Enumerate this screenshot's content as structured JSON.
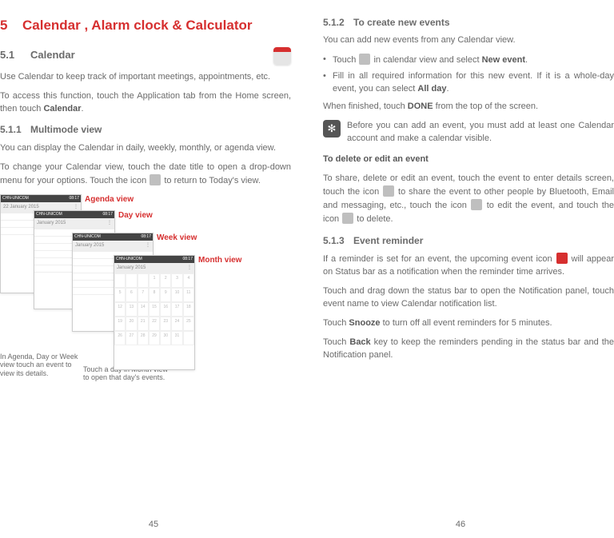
{
  "left": {
    "chapter_num": "5",
    "chapter_title": "Calendar , Alarm clock & Calculator",
    "s1_num": "5.1",
    "s1_title": "Calendar",
    "s1_p1a": "Use Calendar to keep track of important meetings, appointments, etc.",
    "s1_p2a": "To access this function, touch the Application tab from the Home screen, then touch ",
    "s1_p2b": "Calendar",
    "s1_p2c": ".",
    "s11_num": "5.1.1",
    "s11_title": "Multimode view",
    "s11_p1": "You can display the Calendar in daily, weekly, monthly, or agenda view.",
    "s11_p2a": "To change your Calendar view, touch the date title to open a drop-down menu for your options. Touch the icon ",
    "s11_p2b": " to return to Today's view.",
    "cap_agenda": "Agenda view",
    "cap_day": "Day view",
    "cap_week": "Week view",
    "cap_month": "Month view",
    "fn1": "In Agenda, Day or Week view touch an event to view its details.",
    "fn2": "Touch a day in Month view to open that day's events.",
    "phone_date": "22 January 2015",
    "phone_month": "January 2015",
    "page_num": "45"
  },
  "right": {
    "s12_num": "5.1.2",
    "s12_title": "To create new events",
    "s12_p1": "You can add new events from any Calendar view.",
    "s12_b1a": "Touch ",
    "s12_b1b": " in calendar view and select ",
    "s12_b1c": "New event",
    "s12_b1d": ".",
    "s12_b2a": "Fill in all required information for this new event. If it is a whole-day event, you can select ",
    "s12_b2b": "All day",
    "s12_b2c": ".",
    "s12_p2a": "When finished, touch ",
    "s12_p2b": "DONE",
    "s12_p2c": " from the top of the screen.",
    "s12_note": "Before you can add an event, you must add at least one Calendar account and make a calendar visible.",
    "del_title": "To delete or edit an event",
    "del_p1a": "To share, delete or edit an event, touch the event to enter details screen, touch the icon ",
    "del_p1b": " to share the event to other people by Bluetooth, Email and messaging, etc., touch the icon ",
    "del_p1c": " to edit the event, and touch the icon ",
    "del_p1d": " to delete.",
    "s13_num": "5.1.3",
    "s13_title": "Event reminder",
    "s13_p1a": "If a reminder is set for an event, the upcoming event icon ",
    "s13_p1b": " will appear on Status bar as a notification when the reminder time arrives.",
    "s13_p2": "Touch and drag down the status bar to open the Notification panel, touch event name to view Calendar notification list.",
    "s13_p3a": "Touch ",
    "s13_p3b": "Snooze",
    "s13_p3c": " to turn off all event reminders for 5 minutes.",
    "s13_p4a": "Touch ",
    "s13_p4b": "Back",
    "s13_p4c": " key to keep the reminders pending in the status bar and the Notification panel.",
    "page_num": "46"
  }
}
